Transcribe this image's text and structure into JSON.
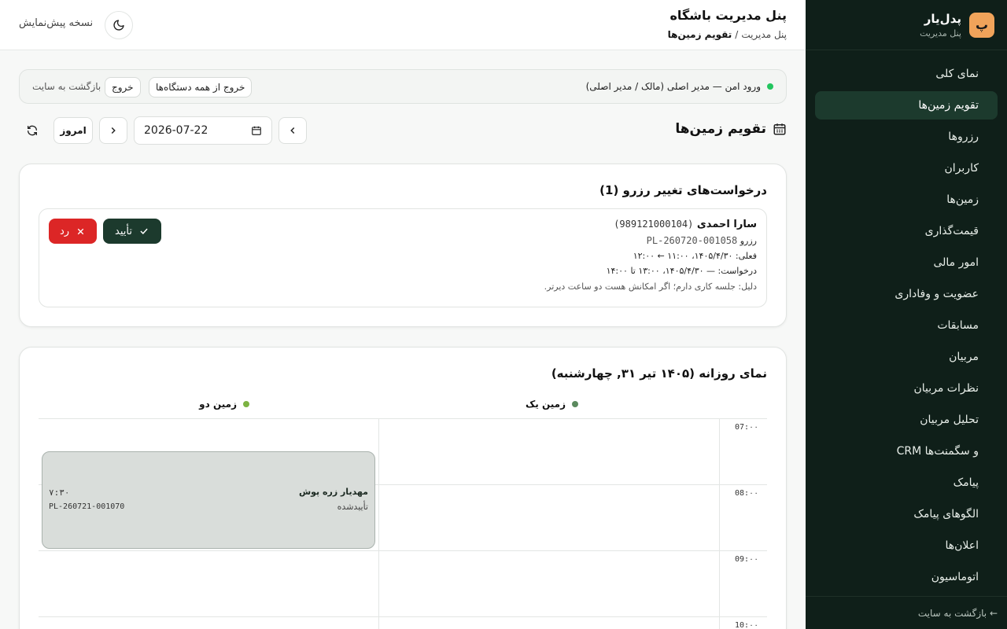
{
  "sidebar": {
    "brand_name": "پدل‌یار",
    "brand_sub": "پنل مدیریت",
    "logo_letter": "پ",
    "items": [
      {
        "label": "نمای کلی"
      },
      {
        "label": "تقویم زمین‌ها",
        "active": true
      },
      {
        "label": "رزروها"
      },
      {
        "label": "کاربران"
      },
      {
        "label": "زمین‌ها"
      },
      {
        "label": "قیمت‌گذاری"
      },
      {
        "label": "امور مالی"
      },
      {
        "label": "عضویت و وفاداری"
      },
      {
        "label": "مسابقات"
      },
      {
        "label": "مربیان"
      },
      {
        "label": "نظرات مربیان"
      },
      {
        "label": "تحلیل مربیان"
      },
      {
        "label": "CRM و سگمنت‌ها"
      },
      {
        "label": "پیامک"
      },
      {
        "label": "الگوهای پیامک"
      },
      {
        "label": "اعلان‌ها"
      },
      {
        "label": "اتوماسیون"
      }
    ],
    "footer": "بازگشت به سایت ←"
  },
  "topbar": {
    "title": "پنل مدیریت باشگاه",
    "crumb_root": "پنل مدیریت",
    "crumb_sep": "/",
    "crumb_current": "تقویم زمین‌ها",
    "preview_label": "نسخه پیش‌نمایش"
  },
  "secure": {
    "text": "ورود امن — مدیر اصلی (مالک / مدیر اصلی)",
    "logout_all": "خروج از همه دستگاه‌ها",
    "logout": "خروج",
    "back": "بازگشت به سایت"
  },
  "calendar_toolbar": {
    "title": "تقویم زمین‌ها",
    "date": "2026-07-22",
    "today": "امروز"
  },
  "requests": {
    "title": "درخواست‌های تغییر رزرو (1)",
    "item": {
      "name": "سارا احمدی",
      "phone": "(989121000104)",
      "booking_label": "رزرو",
      "booking_code": "PL-260720-001058",
      "current": "فعلی: ۱۴۰۵/۴/۳۰، ۱۱:۰۰ ← ۱۲:۰۰",
      "requested": "درخواست: — ۱۴۰۵/۴/۳۰، ۱۳:۰۰ تا ۱۴:۰۰",
      "reason": "دلیل: جلسه کاری دارم؛ اگر امکانش هست دو ساعت دیرتر."
    },
    "approve": "تأیید",
    "reject": "رد"
  },
  "daily": {
    "title": "نمای روزانه (۱۴۰۵ تیر ۳۱, چهارشنبه)",
    "courts": [
      {
        "name": "زمین یک",
        "color": "#5b8a5e"
      },
      {
        "name": "زمین دو",
        "color": "#7cb342"
      }
    ],
    "times": [
      "07:۰۰",
      "08:۰۰",
      "09:۰۰",
      "10:۰۰"
    ],
    "booking": {
      "name": "مهدیار زره پوش",
      "status": "تأییدشده",
      "time": "۷:۳۰",
      "code": "PL-260721-001070"
    }
  },
  "colors": {
    "sidebar_bg": "#0f1f19",
    "accent": "#1c3a2d",
    "danger": "#dc2626",
    "brand": "#f0a35a"
  }
}
